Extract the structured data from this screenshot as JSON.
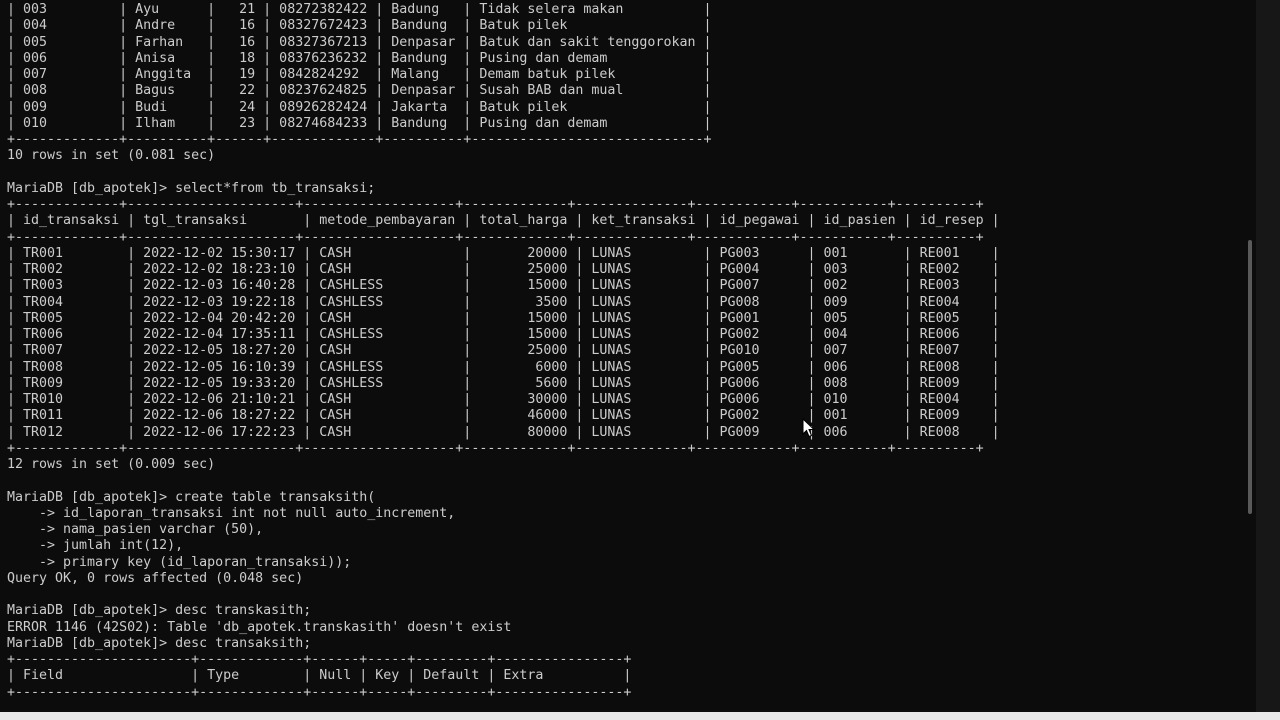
{
  "terminal": {
    "lines": [
      "| 003         | Ayu      |   21 | 08272382422 | Badung   | Tidak selera makan          |",
      "| 004         | Andre    |   16 | 08327672423 | Bandung  | Batuk pilek                 |",
      "| 005         | Farhan   |   16 | 08327367213 | Denpasar | Batuk dan sakit tenggorokan |",
      "| 006         | Anisa    |   18 | 08376236232 | Bandung  | Pusing dan demam            |",
      "| 007         | Anggita  |   19 | 0842824292  | Malang   | Demam batuk pilek           |",
      "| 008         | Bagus    |   22 | 08237624825 | Denpasar | Susah BAB dan mual          |",
      "| 009         | Budi     |   24 | 08926282424 | Jakarta  | Batuk pilek                 |",
      "| 010         | Ilham    |   23 | 08274684233 | Bandung  | Pusing dan demam            |",
      "+-------------+----------+------+-------------+----------+-----------------------------+",
      "10 rows in set (0.081 sec)",
      "",
      "MariaDB [db_apotek]> select*from tb_transaksi;",
      "+-------------+---------------------+-------------------+-------------+--------------+------------+-----------+----------+",
      "| id_transaksi | tgl_transaksi       | metode_pembayaran | total_harga | ket_transaksi | id_pegawai | id_pasien | id_resep |",
      "+-------------+---------------------+-------------------+-------------+--------------+------------+-----------+----------+",
      "| TR001        | 2022-12-02 15:30:17 | CASH              |       20000 | LUNAS         | PG003      | 001       | RE001    |",
      "| TR002        | 2022-12-02 18:23:10 | CASH              |       25000 | LUNAS         | PG004      | 003       | RE002    |",
      "| TR003        | 2022-12-03 16:40:28 | CASHLESS          |       15000 | LUNAS         | PG007      | 002       | RE003    |",
      "| TR004        | 2022-12-03 19:22:18 | CASHLESS          |        3500 | LUNAS         | PG008      | 009       | RE004    |",
      "| TR005        | 2022-12-04 20:42:20 | CASH              |       15000 | LUNAS         | PG001      | 005       | RE005    |",
      "| TR006        | 2022-12-04 17:35:11 | CASHLESS          |       15000 | LUNAS         | PG002      | 004       | RE006    |",
      "| TR007        | 2022-12-05 18:27:20 | CASH              |       25000 | LUNAS         | PG010      | 007       | RE007    |",
      "| TR008        | 2022-12-05 16:10:39 | CASHLESS          |        6000 | LUNAS         | PG005      | 006       | RE008    |",
      "| TR009        | 2022-12-05 19:33:20 | CASHLESS          |        5600 | LUNAS         | PG006      | 008       | RE009    |",
      "| TR010        | 2022-12-06 21:10:21 | CASH              |       30000 | LUNAS         | PG006      | 010       | RE004    |",
      "| TR011        | 2022-12-06 18:27:22 | CASH              |       46000 | LUNAS         | PG002      | 001       | RE009    |",
      "| TR012        | 2022-12-06 17:22:23 | CASH              |       80000 | LUNAS         | PG009      | 006       | RE008    |",
      "+-------------+---------------------+-------------------+-------------+--------------+------------+-----------+----------+",
      "12 rows in set (0.009 sec)",
      "",
      "MariaDB [db_apotek]> create table transaksith(",
      "    -> id_laporan_transaksi int not null auto_increment,",
      "    -> nama_pasien varchar (50),",
      "    -> jumlah int(12),",
      "    -> primary key (id_laporan_transaksi));",
      "Query OK, 0 rows affected (0.048 sec)",
      "",
      "MariaDB [db_apotek]> desc transkasith;",
      "ERROR 1146 (42S02): Table 'db_apotek.transkasith' doesn't exist",
      "MariaDB [db_apotek]> desc transaksith;",
      "+----------------------+-------------+------+-----+---------+----------------+",
      "| Field                | Type        | Null | Key | Default | Extra          |",
      "+----------------------+-------------+------+-----+---------+----------------+"
    ]
  },
  "colors": {
    "background": "#0c0c0c",
    "text": "#cccccc",
    "scrollbar_thumb": "#5a5a5a"
  },
  "icons": {
    "cursor": "mouse-pointer-icon"
  }
}
